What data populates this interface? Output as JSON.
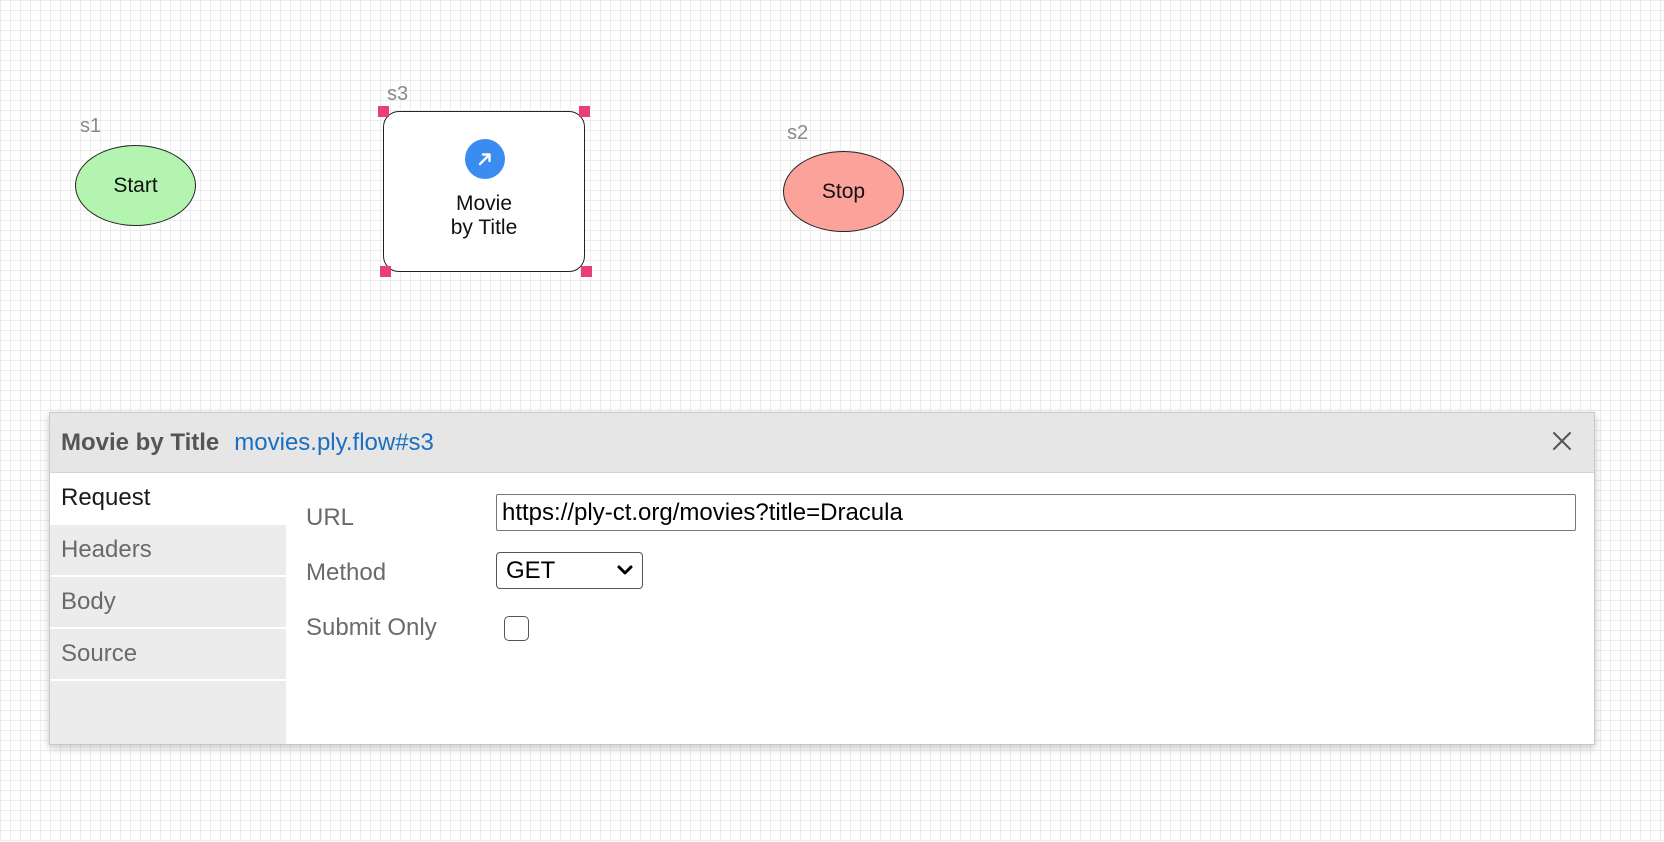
{
  "diagram": {
    "start": {
      "id": "s1",
      "label": "Start",
      "fill": "#b3f5b0"
    },
    "request": {
      "id": "s3",
      "label_line1": "Movie",
      "label_line2": "by Title",
      "icon": "arrow-up-right-icon",
      "icon_color": "#3b8cf0",
      "selected": true,
      "handle_color": "#e83f7c"
    },
    "stop": {
      "id": "s2",
      "label": "Stop",
      "fill": "#fba39b"
    }
  },
  "panel": {
    "title": "Movie by Title",
    "link": "movies.ply.flow#s3",
    "link_color": "#1a6fc0",
    "close_icon": "close-icon",
    "tabs": [
      {
        "label": "Request",
        "active": true
      },
      {
        "label": "Headers",
        "active": false
      },
      {
        "label": "Body",
        "active": false
      },
      {
        "label": "Source",
        "active": false
      }
    ],
    "fields": {
      "url_label": "URL",
      "url_value": "https://ply-ct.org/movies?title=Dracula",
      "method_label": "Method",
      "method_value": "GET",
      "submit_only_label": "Submit Only",
      "submit_only_checked": false
    }
  }
}
